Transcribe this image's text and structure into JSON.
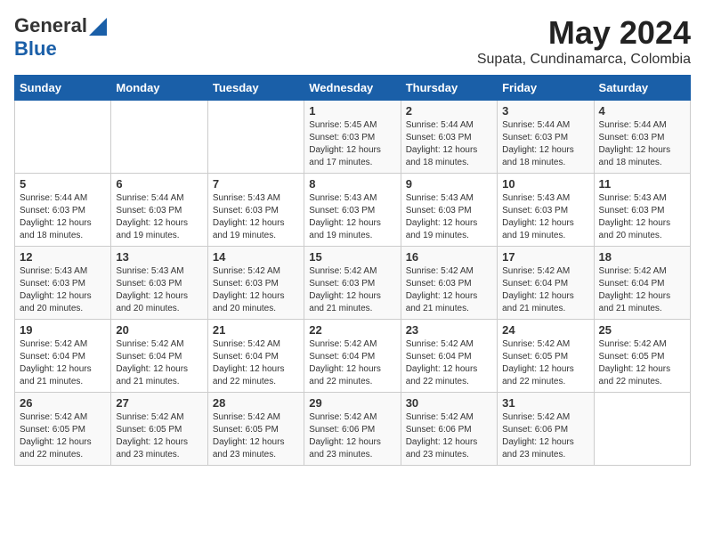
{
  "header": {
    "logo_general": "General",
    "logo_blue": "Blue",
    "month_year": "May 2024",
    "location": "Supata, Cundinamarca, Colombia"
  },
  "weekdays": [
    "Sunday",
    "Monday",
    "Tuesday",
    "Wednesday",
    "Thursday",
    "Friday",
    "Saturday"
  ],
  "weeks": [
    [
      {
        "day": "",
        "info": ""
      },
      {
        "day": "",
        "info": ""
      },
      {
        "day": "",
        "info": ""
      },
      {
        "day": "1",
        "info": "Sunrise: 5:45 AM\nSunset: 6:03 PM\nDaylight: 12 hours\nand 17 minutes."
      },
      {
        "day": "2",
        "info": "Sunrise: 5:44 AM\nSunset: 6:03 PM\nDaylight: 12 hours\nand 18 minutes."
      },
      {
        "day": "3",
        "info": "Sunrise: 5:44 AM\nSunset: 6:03 PM\nDaylight: 12 hours\nand 18 minutes."
      },
      {
        "day": "4",
        "info": "Sunrise: 5:44 AM\nSunset: 6:03 PM\nDaylight: 12 hours\nand 18 minutes."
      }
    ],
    [
      {
        "day": "5",
        "info": "Sunrise: 5:44 AM\nSunset: 6:03 PM\nDaylight: 12 hours\nand 18 minutes."
      },
      {
        "day": "6",
        "info": "Sunrise: 5:44 AM\nSunset: 6:03 PM\nDaylight: 12 hours\nand 19 minutes."
      },
      {
        "day": "7",
        "info": "Sunrise: 5:43 AM\nSunset: 6:03 PM\nDaylight: 12 hours\nand 19 minutes."
      },
      {
        "day": "8",
        "info": "Sunrise: 5:43 AM\nSunset: 6:03 PM\nDaylight: 12 hours\nand 19 minutes."
      },
      {
        "day": "9",
        "info": "Sunrise: 5:43 AM\nSunset: 6:03 PM\nDaylight: 12 hours\nand 19 minutes."
      },
      {
        "day": "10",
        "info": "Sunrise: 5:43 AM\nSunset: 6:03 PM\nDaylight: 12 hours\nand 19 minutes."
      },
      {
        "day": "11",
        "info": "Sunrise: 5:43 AM\nSunset: 6:03 PM\nDaylight: 12 hours\nand 20 minutes."
      }
    ],
    [
      {
        "day": "12",
        "info": "Sunrise: 5:43 AM\nSunset: 6:03 PM\nDaylight: 12 hours\nand 20 minutes."
      },
      {
        "day": "13",
        "info": "Sunrise: 5:43 AM\nSunset: 6:03 PM\nDaylight: 12 hours\nand 20 minutes."
      },
      {
        "day": "14",
        "info": "Sunrise: 5:42 AM\nSunset: 6:03 PM\nDaylight: 12 hours\nand 20 minutes."
      },
      {
        "day": "15",
        "info": "Sunrise: 5:42 AM\nSunset: 6:03 PM\nDaylight: 12 hours\nand 21 minutes."
      },
      {
        "day": "16",
        "info": "Sunrise: 5:42 AM\nSunset: 6:03 PM\nDaylight: 12 hours\nand 21 minutes."
      },
      {
        "day": "17",
        "info": "Sunrise: 5:42 AM\nSunset: 6:04 PM\nDaylight: 12 hours\nand 21 minutes."
      },
      {
        "day": "18",
        "info": "Sunrise: 5:42 AM\nSunset: 6:04 PM\nDaylight: 12 hours\nand 21 minutes."
      }
    ],
    [
      {
        "day": "19",
        "info": "Sunrise: 5:42 AM\nSunset: 6:04 PM\nDaylight: 12 hours\nand 21 minutes."
      },
      {
        "day": "20",
        "info": "Sunrise: 5:42 AM\nSunset: 6:04 PM\nDaylight: 12 hours\nand 21 minutes."
      },
      {
        "day": "21",
        "info": "Sunrise: 5:42 AM\nSunset: 6:04 PM\nDaylight: 12 hours\nand 22 minutes."
      },
      {
        "day": "22",
        "info": "Sunrise: 5:42 AM\nSunset: 6:04 PM\nDaylight: 12 hours\nand 22 minutes."
      },
      {
        "day": "23",
        "info": "Sunrise: 5:42 AM\nSunset: 6:04 PM\nDaylight: 12 hours\nand 22 minutes."
      },
      {
        "day": "24",
        "info": "Sunrise: 5:42 AM\nSunset: 6:05 PM\nDaylight: 12 hours\nand 22 minutes."
      },
      {
        "day": "25",
        "info": "Sunrise: 5:42 AM\nSunset: 6:05 PM\nDaylight: 12 hours\nand 22 minutes."
      }
    ],
    [
      {
        "day": "26",
        "info": "Sunrise: 5:42 AM\nSunset: 6:05 PM\nDaylight: 12 hours\nand 22 minutes."
      },
      {
        "day": "27",
        "info": "Sunrise: 5:42 AM\nSunset: 6:05 PM\nDaylight: 12 hours\nand 23 minutes."
      },
      {
        "day": "28",
        "info": "Sunrise: 5:42 AM\nSunset: 6:05 PM\nDaylight: 12 hours\nand 23 minutes."
      },
      {
        "day": "29",
        "info": "Sunrise: 5:42 AM\nSunset: 6:06 PM\nDaylight: 12 hours\nand 23 minutes."
      },
      {
        "day": "30",
        "info": "Sunrise: 5:42 AM\nSunset: 6:06 PM\nDaylight: 12 hours\nand 23 minutes."
      },
      {
        "day": "31",
        "info": "Sunrise: 5:42 AM\nSunset: 6:06 PM\nDaylight: 12 hours\nand 23 minutes."
      },
      {
        "day": "",
        "info": ""
      }
    ]
  ]
}
